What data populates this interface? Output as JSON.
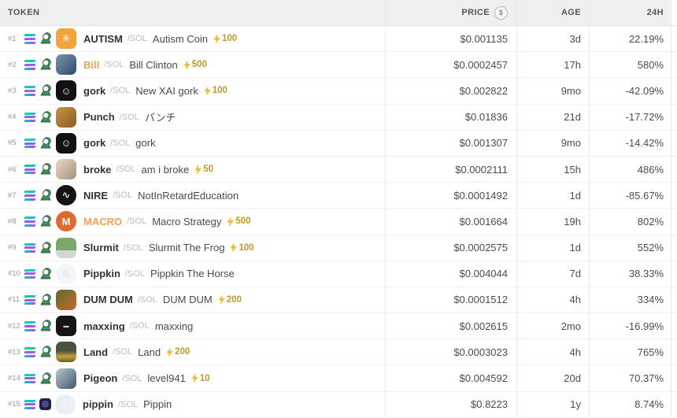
{
  "header": {
    "token_label": "TOKEN",
    "price_label": "PRICE",
    "price_unit_icon": "dollar-circle-icon",
    "price_unit_symbol": "$",
    "age_label": "AGE",
    "change_label": "24H"
  },
  "icons": {
    "chain": "solana-icon",
    "dex_green": "pumpswap-icon",
    "dex_alt": "alt-launchpad-icon",
    "boost": "lightning-bolt-icon"
  },
  "colors": {
    "positive": "#3fae85",
    "negative": "#e25764",
    "boost_text": "#c49a1c",
    "boost_bolt": "#f3ba2f",
    "symbol_orange": "#f0a14e",
    "header_bg": "#efefef"
  },
  "rows": [
    {
      "rank": "#1",
      "symbol": "AUTISM",
      "symbol_color": "default",
      "pair": "/SOL",
      "name": "Autism Coin",
      "boost": "100",
      "price": "$0.001135",
      "age": "3d",
      "change": "22.19%",
      "change_dir": "up",
      "dex": "pump",
      "avatar": {
        "bg": "#f2a33c",
        "fg": "#ffffff",
        "glyph": "✳",
        "shape": "rounded"
      }
    },
    {
      "rank": "#2",
      "symbol": "Bill",
      "symbol_color": "orange",
      "pair": "/SOL",
      "name": "Bill Clinton",
      "boost": "500",
      "price": "$0.0002457",
      "age": "17h",
      "change": "580%",
      "change_dir": "up",
      "dex": "pump",
      "avatar": {
        "bg": "linear-gradient(135deg,#7d94ad,#2e4a6b)",
        "fg": "#e8eef5",
        "glyph": "",
        "shape": "rounded"
      }
    },
    {
      "rank": "#3",
      "symbol": "gork",
      "symbol_color": "default",
      "pair": "/SOL",
      "name": "New XAI gork",
      "boost": "100",
      "price": "$0.002822",
      "age": "9mo",
      "change": "-42.09%",
      "change_dir": "down",
      "dex": "pump",
      "avatar": {
        "bg": "#111111",
        "fg": "#e8e8e8",
        "glyph": "☺",
        "shape": "rounded"
      }
    },
    {
      "rank": "#4",
      "symbol": "Punch",
      "symbol_color": "default",
      "pair": "/SOL",
      "name": "パンチ",
      "boost": "",
      "price": "$0.01836",
      "age": "21d",
      "change": "-17.72%",
      "change_dir": "down",
      "dex": "pump",
      "avatar": {
        "bg": "linear-gradient(135deg,#c7953f,#8a5a2e)",
        "fg": "#ffffff",
        "glyph": "",
        "shape": "rounded"
      }
    },
    {
      "rank": "#5",
      "symbol": "gork",
      "symbol_color": "default",
      "pair": "/SOL",
      "name": "gork",
      "boost": "",
      "price": "$0.001307",
      "age": "9mo",
      "change": "-14.42%",
      "change_dir": "down",
      "dex": "pump",
      "avatar": {
        "bg": "#111111",
        "fg": "#e8e8e8",
        "glyph": "☺",
        "shape": "rounded"
      }
    },
    {
      "rank": "#6",
      "symbol": "broke",
      "symbol_color": "default",
      "pair": "/SOL",
      "name": "am i broke",
      "boost": "50",
      "price": "$0.0002111",
      "age": "15h",
      "change": "486%",
      "change_dir": "up",
      "dex": "pump",
      "avatar": {
        "bg": "linear-gradient(135deg,#e8d9c8,#a8917c)",
        "fg": "#6b5b4a",
        "glyph": "",
        "shape": "rounded"
      }
    },
    {
      "rank": "#7",
      "symbol": "NIRE",
      "symbol_color": "default",
      "pair": "/SOL",
      "name": "NotInRetardEducation",
      "boost": "",
      "price": "$0.0001492",
      "age": "1d",
      "change": "-85.67%",
      "change_dir": "down",
      "dex": "pump",
      "avatar": {
        "bg": "#141414",
        "fg": "#dddddd",
        "glyph": "∿",
        "shape": "circle"
      }
    },
    {
      "rank": "#8",
      "symbol": "MACRO",
      "symbol_color": "orange",
      "pair": "/SOL",
      "name": "Macro Strategy",
      "boost": "500",
      "price": "$0.001664",
      "age": "19h",
      "change": "802%",
      "change_dir": "up",
      "dex": "pump",
      "avatar": {
        "bg": "#e2692e",
        "fg": "#ffffff",
        "glyph": "M",
        "shape": "circle"
      }
    },
    {
      "rank": "#9",
      "symbol": "Slurmit",
      "symbol_color": "default",
      "pair": "/SOL",
      "name": "Slurmit The Frog",
      "boost": "100",
      "price": "$0.0002575",
      "age": "1d",
      "change": "552%",
      "change_dir": "up",
      "dex": "pump",
      "avatar": {
        "bg": "linear-gradient(180deg,#7aa96b 62%,#cfd8d2 62%)",
        "fg": "#3d5c33",
        "glyph": "",
        "shape": "rounded"
      }
    },
    {
      "rank": "#10",
      "symbol": "Pippkin",
      "symbol_color": "default",
      "pair": "/SOL",
      "name": "Pippkin The Horse",
      "boost": "",
      "price": "$0.004044",
      "age": "7d",
      "change": "38.33%",
      "change_dir": "up",
      "dex": "pump",
      "avatar": {
        "bg": "#f3f6f8",
        "fg": "#c3ccd6",
        "glyph": "♘",
        "shape": "circle"
      }
    },
    {
      "rank": "#11",
      "symbol": "DUM DUM",
      "symbol_color": "default",
      "pair": "/SOL",
      "name": "DUM DUM",
      "boost": "200",
      "price": "$0.0001512",
      "age": "4h",
      "change": "334%",
      "change_dir": "up",
      "dex": "pump",
      "avatar": {
        "bg": "linear-gradient(135deg,#5a6b33,#cc6a2a)",
        "fg": "#ffd9a8",
        "glyph": "",
        "shape": "rounded"
      }
    },
    {
      "rank": "#12",
      "symbol": "maxxing",
      "symbol_color": "default",
      "pair": "/SOL",
      "name": "maxxing",
      "boost": "",
      "price": "$0.002615",
      "age": "2mo",
      "change": "-16.99%",
      "change_dir": "down",
      "dex": "pump",
      "avatar": {
        "bg": "#151515",
        "fg": "#cfcfcf",
        "glyph": "▬",
        "shape": "rounded"
      }
    },
    {
      "rank": "#13",
      "symbol": "Land",
      "symbol_color": "default",
      "pair": "/SOL",
      "name": "Land",
      "boost": "200",
      "price": "$0.0003023",
      "age": "4h",
      "change": "765%",
      "change_dir": "up",
      "dex": "pump",
      "avatar": {
        "bg": "linear-gradient(180deg,#49523f 45%,#caa13c 72%,#6b5a2e)",
        "fg": "#ffffff",
        "glyph": "",
        "shape": "rounded"
      }
    },
    {
      "rank": "#14",
      "symbol": "Pigeon",
      "symbol_color": "default",
      "pair": "/SOL",
      "name": "level941",
      "boost": "10",
      "price": "$0.004592",
      "age": "20d",
      "change": "70.37%",
      "change_dir": "up",
      "dex": "pump",
      "avatar": {
        "bg": "linear-gradient(135deg,#b9c7d1,#41586b)",
        "fg": "#2e3f4d",
        "glyph": "",
        "shape": "rounded"
      }
    },
    {
      "rank": "#15",
      "symbol": "pippin",
      "symbol_color": "default",
      "pair": "/SOL",
      "name": "Pippin",
      "boost": "",
      "price": "$0.8223",
      "age": "1y",
      "change": "8.74%",
      "change_dir": "up",
      "dex": "alt",
      "avatar": {
        "bg": "#e9eff5",
        "fg": "#ffffff",
        "glyph": "♘",
        "shape": "circle"
      }
    }
  ]
}
